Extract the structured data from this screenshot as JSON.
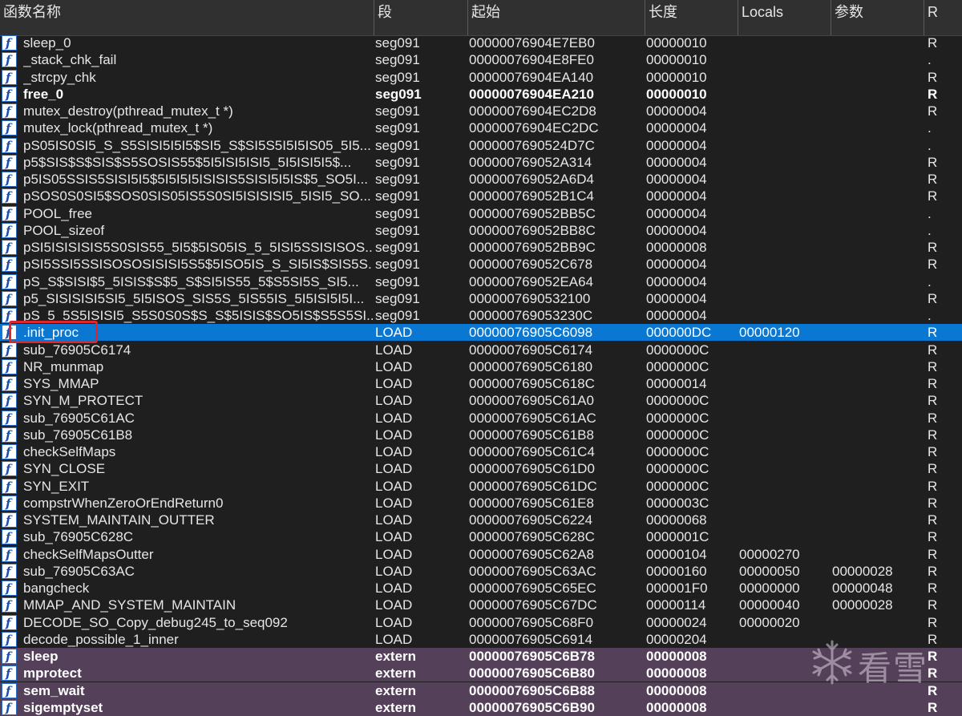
{
  "columns": [
    "函数名称",
    "段",
    "起始",
    "长度",
    "Locals",
    "参数",
    "R"
  ],
  "icon_name": "function-icon",
  "rows": [
    {
      "name": "sleep_0",
      "segment": "seg091",
      "start": "00000076904E7EB0",
      "length": "00000010",
      "locals": "",
      "args": "",
      "r": "R",
      "style": "normal"
    },
    {
      "name": "_stack_chk_fail",
      "segment": "seg091",
      "start": "00000076904E8FE0",
      "length": "00000010",
      "locals": "",
      "args": "",
      "r": ".",
      "style": "normal"
    },
    {
      "name": "_strcpy_chk",
      "segment": "seg091",
      "start": "00000076904EA140",
      "length": "00000010",
      "locals": "",
      "args": "",
      "r": "R",
      "style": "normal"
    },
    {
      "name": "free_0",
      "segment": "seg091",
      "start": "00000076904EA210",
      "length": "00000010",
      "locals": "",
      "args": "",
      "r": "R",
      "style": "bold"
    },
    {
      "name": "mutex_destroy(pthread_mutex_t *)",
      "segment": "seg091",
      "start": "00000076904EC2D8",
      "length": "00000004",
      "locals": "",
      "args": "",
      "r": "R",
      "style": "normal"
    },
    {
      "name": "mutex_lock(pthread_mutex_t *)",
      "segment": "seg091",
      "start": "00000076904EC2DC",
      "length": "00000004",
      "locals": "",
      "args": "",
      "r": ".",
      "style": "normal"
    },
    {
      "name": "pS05IS0SI5_S_S5SISI5I5I5$SI5_S$SI5S5I5I5IS05_5I5...",
      "segment": "seg091",
      "start": "0000007690524D7C",
      "length": "00000004",
      "locals": "",
      "args": "",
      "r": ".",
      "style": "normal"
    },
    {
      "name": "p5$SIS$S$SIS$S5SOSIS55$5I5ISI5ISI5_5I5ISI5I5$...",
      "segment": "seg091",
      "start": "000000769052A314",
      "length": "00000004",
      "locals": "",
      "args": "",
      "r": "R",
      "style": "normal"
    },
    {
      "name": "p5IS05SSIS5SISI5I5$5I5I5I5ISISIS5SISI5I5IS$5_SO5I...",
      "segment": "seg091",
      "start": "000000769052A6D4",
      "length": "00000004",
      "locals": "",
      "args": "",
      "r": "R",
      "style": "normal"
    },
    {
      "name": "pSOS0S0SI5$SOS0SIS05IS5S0SI5ISISISI5_5ISI5_SO...",
      "segment": "seg091",
      "start": "000000769052B1C4",
      "length": "00000004",
      "locals": "",
      "args": "",
      "r": "R",
      "style": "normal"
    },
    {
      "name": "POOL_free",
      "segment": "seg091",
      "start": "000000769052BB5C",
      "length": "00000004",
      "locals": "",
      "args": "",
      "r": ".",
      "style": "normal"
    },
    {
      "name": "POOL_sizeof",
      "segment": "seg091",
      "start": "000000769052BB8C",
      "length": "00000004",
      "locals": "",
      "args": "",
      "r": ".",
      "style": "normal"
    },
    {
      "name": "pSI5ISISISIS5S0SIS55_5I5$5IS05IS_5_5ISI5SSISISOS...",
      "segment": "seg091",
      "start": "000000769052BB9C",
      "length": "00000008",
      "locals": "",
      "args": "",
      "r": "R",
      "style": "normal"
    },
    {
      "name": "pSI5SSI5SSISOSOSISISI5S5$5ISO5IS_S_SI5IS$SIS5S...",
      "segment": "seg091",
      "start": "000000769052C678",
      "length": "00000004",
      "locals": "",
      "args": "",
      "r": "R",
      "style": "normal"
    },
    {
      "name": "pS_S$SISI$5_5ISIS$S$5_S$SI5IS55_5$S5SI5S_SI5...",
      "segment": "seg091",
      "start": "000000769052EA64",
      "length": "00000004",
      "locals": "",
      "args": "",
      "r": ".",
      "style": "normal"
    },
    {
      "name": "p5_SISISISI5SI5_5I5ISOS_SIS5S_5IS55IS_5I5ISI5I5I...",
      "segment": "seg091",
      "start": "0000007690532100",
      "length": "00000004",
      "locals": "",
      "args": "",
      "r": "R",
      "style": "normal"
    },
    {
      "name": "pS_5_5S5ISISI5_S5S0S0S$S_S$5ISIS$SO5IS$S5S5SI...",
      "segment": "seg091",
      "start": "000000769053230C",
      "length": "00000004",
      "locals": "",
      "args": "",
      "r": ".",
      "style": "normal"
    },
    {
      "name": ".init_proc",
      "segment": "LOAD",
      "start": "00000076905C6098",
      "length": "000000DC",
      "locals": "00000120",
      "args": "",
      "r": "R",
      "style": "selected"
    },
    {
      "name": "sub_76905C6174",
      "segment": "LOAD",
      "start": "00000076905C6174",
      "length": "0000000C",
      "locals": "",
      "args": "",
      "r": "R",
      "style": "normal"
    },
    {
      "name": "NR_munmap",
      "segment": "LOAD",
      "start": "00000076905C6180",
      "length": "0000000C",
      "locals": "",
      "args": "",
      "r": "R",
      "style": "normal"
    },
    {
      "name": "SYS_MMAP",
      "segment": "LOAD",
      "start": "00000076905C618C",
      "length": "00000014",
      "locals": "",
      "args": "",
      "r": "R",
      "style": "normal"
    },
    {
      "name": "SYN_M_PROTECT",
      "segment": "LOAD",
      "start": "00000076905C61A0",
      "length": "0000000C",
      "locals": "",
      "args": "",
      "r": "R",
      "style": "normal"
    },
    {
      "name": "sub_76905C61AC",
      "segment": "LOAD",
      "start": "00000076905C61AC",
      "length": "0000000C",
      "locals": "",
      "args": "",
      "r": "R",
      "style": "normal"
    },
    {
      "name": "sub_76905C61B8",
      "segment": "LOAD",
      "start": "00000076905C61B8",
      "length": "0000000C",
      "locals": "",
      "args": "",
      "r": "R",
      "style": "normal"
    },
    {
      "name": "checkSelfMaps",
      "segment": "LOAD",
      "start": "00000076905C61C4",
      "length": "0000000C",
      "locals": "",
      "args": "",
      "r": "R",
      "style": "normal"
    },
    {
      "name": "SYN_CLOSE",
      "segment": "LOAD",
      "start": "00000076905C61D0",
      "length": "0000000C",
      "locals": "",
      "args": "",
      "r": "R",
      "style": "normal"
    },
    {
      "name": "SYN_EXIT",
      "segment": "LOAD",
      "start": "00000076905C61DC",
      "length": "0000000C",
      "locals": "",
      "args": "",
      "r": "R",
      "style": "normal"
    },
    {
      "name": "compstrWhenZeroOrEndReturn0",
      "segment": "LOAD",
      "start": "00000076905C61E8",
      "length": "0000003C",
      "locals": "",
      "args": "",
      "r": "R",
      "style": "normal"
    },
    {
      "name": "SYSTEM_MAINTAIN_OUTTER",
      "segment": "LOAD",
      "start": "00000076905C6224",
      "length": "00000068",
      "locals": "",
      "args": "",
      "r": "R",
      "style": "normal"
    },
    {
      "name": "sub_76905C628C",
      "segment": "LOAD",
      "start": "00000076905C628C",
      "length": "0000001C",
      "locals": "",
      "args": "",
      "r": "R",
      "style": "normal"
    },
    {
      "name": "checkSelfMapsOutter",
      "segment": "LOAD",
      "start": "00000076905C62A8",
      "length": "00000104",
      "locals": "00000270",
      "args": "",
      "r": "R",
      "style": "normal"
    },
    {
      "name": "sub_76905C63AC",
      "segment": "LOAD",
      "start": "00000076905C63AC",
      "length": "00000160",
      "locals": "00000050",
      "args": "00000028",
      "r": "R",
      "style": "normal"
    },
    {
      "name": "bangcheck",
      "segment": "LOAD",
      "start": "00000076905C65EC",
      "length": "000001F0",
      "locals": "00000000",
      "args": "00000048",
      "r": "R",
      "style": "normal"
    },
    {
      "name": "MMAP_AND_SYSTEM_MAINTAIN",
      "segment": "LOAD",
      "start": "00000076905C67DC",
      "length": "00000114",
      "locals": "00000040",
      "args": "00000028",
      "r": "R",
      "style": "normal"
    },
    {
      "name": "DECODE_SO_Copy_debug245_to_seq092",
      "segment": "LOAD",
      "start": "00000076905C68F0",
      "length": "00000024",
      "locals": "00000020",
      "args": "",
      "r": "R",
      "style": "normal"
    },
    {
      "name": "decode_possible_1_inner",
      "segment": "LOAD",
      "start": "00000076905C6914",
      "length": "00000204",
      "locals": "",
      "args": "",
      "r": "R",
      "style": "normal"
    },
    {
      "name": "sleep",
      "segment": "extern",
      "start": "00000076905C6B78",
      "length": "00000008",
      "locals": "",
      "args": "",
      "r": "R",
      "style": "extern"
    },
    {
      "name": "mprotect",
      "segment": "extern",
      "start": "00000076905C6B80",
      "length": "00000008",
      "locals": "",
      "args": "",
      "r": "R",
      "style": "extern"
    },
    {
      "name": "sem_wait",
      "segment": "extern",
      "start": "00000076905C6B88",
      "length": "00000008",
      "locals": "",
      "args": "",
      "r": "R",
      "style": "extern"
    },
    {
      "name": "sigemptyset",
      "segment": "extern",
      "start": "00000076905C6B90",
      "length": "00000008",
      "locals": "",
      "args": "",
      "r": "R",
      "style": "extern"
    }
  ],
  "watermark": {
    "text": "看雪",
    "icon_name": "snowflake-logo-icon"
  }
}
